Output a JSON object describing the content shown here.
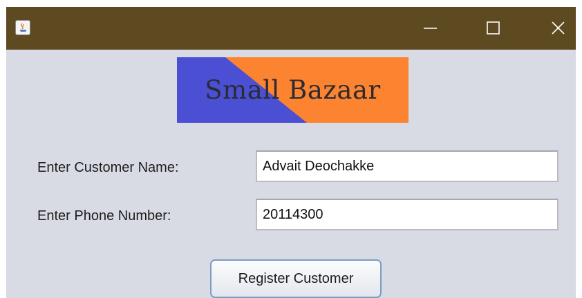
{
  "titlebar": {
    "icon": "java-app-icon",
    "controls": [
      "minimize",
      "maximize",
      "close"
    ],
    "color": "#5e4a21"
  },
  "logo": {
    "text": "Small Bazaar",
    "colors": {
      "left": "#4b4fd3",
      "right": "#fc8330",
      "text": "#2b2b33"
    }
  },
  "form": {
    "name_label": "Enter Customer Name:",
    "name_value": "Advait Deochakke",
    "phone_label": "Enter Phone Number:",
    "phone_value": "20114300",
    "register_label": "Register Customer"
  },
  "colors": {
    "window_background": "#d8dbe3",
    "button_border": "#7b9cc4"
  }
}
